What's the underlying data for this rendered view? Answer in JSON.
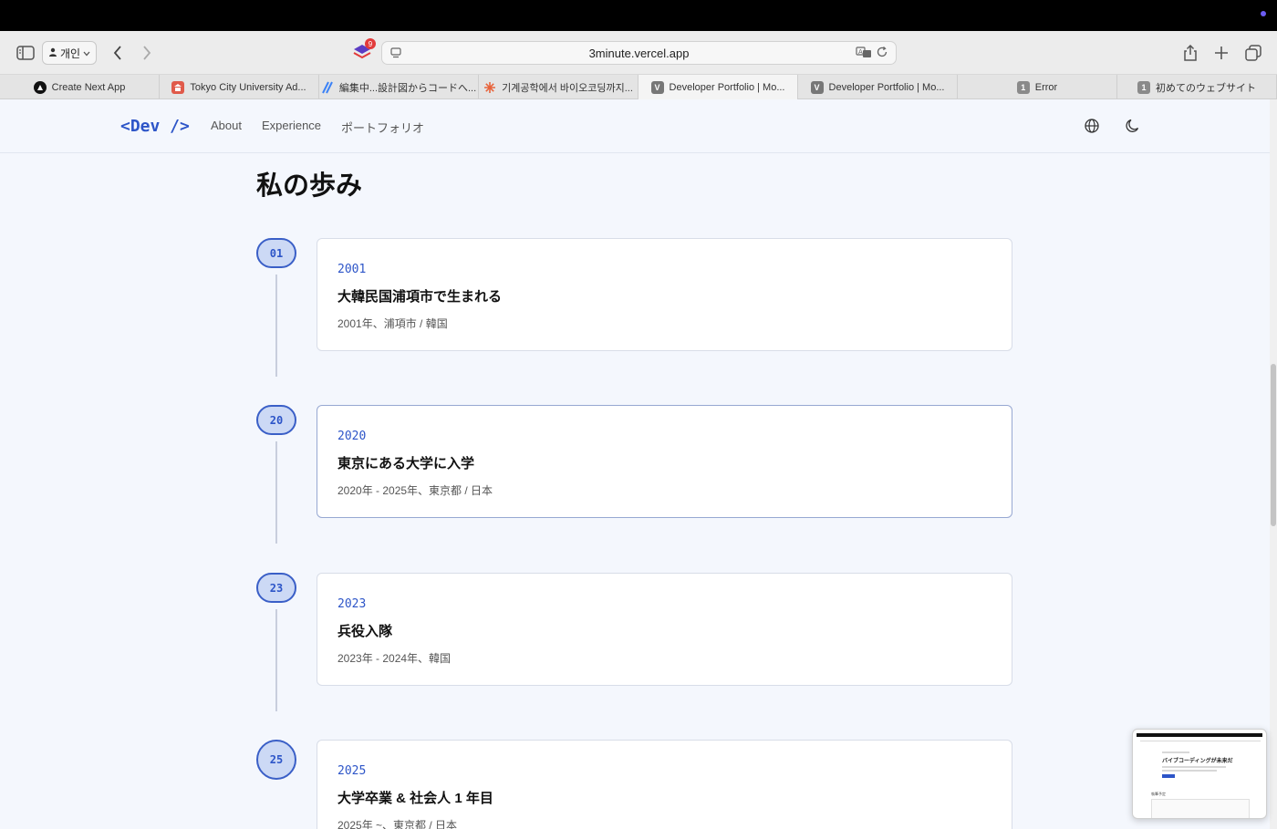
{
  "browser": {
    "profile_label": "개인",
    "extension_badge": "9",
    "url": "3minute.vercel.app",
    "tabs": [
      {
        "label": "Create Next App",
        "favicon": "",
        "favicon_color": "#111111",
        "active": false
      },
      {
        "label": "Tokyo City University Ad...",
        "favicon": "",
        "favicon_color": "#e05a4a",
        "active": false
      },
      {
        "label": "編集中...設計図からコードへ...",
        "favicon": "",
        "favicon_color": "#3b82f6",
        "active": false
      },
      {
        "label": "기계공학에서 바이오코딩까지...",
        "favicon": "",
        "favicon_color": "#e8643c",
        "active": false
      },
      {
        "label": "Developer Portfolio | Mo...",
        "favicon": "V",
        "favicon_color": "#777777",
        "active": true
      },
      {
        "label": "Developer Portfolio | Mo...",
        "favicon": "V",
        "favicon_color": "#777777",
        "active": false
      },
      {
        "label": "Error",
        "favicon": "1",
        "favicon_color": "#8a8a8a",
        "active": false
      },
      {
        "label": "初めてのウェブサイト",
        "favicon": "1",
        "favicon_color": "#8a8a8a",
        "active": false
      }
    ]
  },
  "site": {
    "logo": "<Dev />",
    "nav": [
      "About",
      "Experience",
      "ポートフォリオ"
    ],
    "accent_color": "#2d55c8"
  },
  "timeline": {
    "heading": "私の歩み",
    "entries": [
      {
        "marker": "01",
        "year": "2001",
        "title": "大韓民国浦項市で生まれる",
        "desc": "2001年、浦項市 / 韓国"
      },
      {
        "marker": "20",
        "year": "2020",
        "title": "東京にある大学に入学",
        "desc": "2020年 - 2025年、東京都 / 日本"
      },
      {
        "marker": "23",
        "year": "2023",
        "title": "兵役入隊",
        "desc": "2023年 - 2024年、韓国"
      },
      {
        "marker": "25",
        "year": "2025",
        "title": "大学卒業 & 社会人 1 年目",
        "desc": "2025年 ~、東京都 / 日本"
      }
    ]
  },
  "pip_preview": {
    "title": "バイブコーディングが未来だ",
    "section_label": "執筆予定"
  }
}
